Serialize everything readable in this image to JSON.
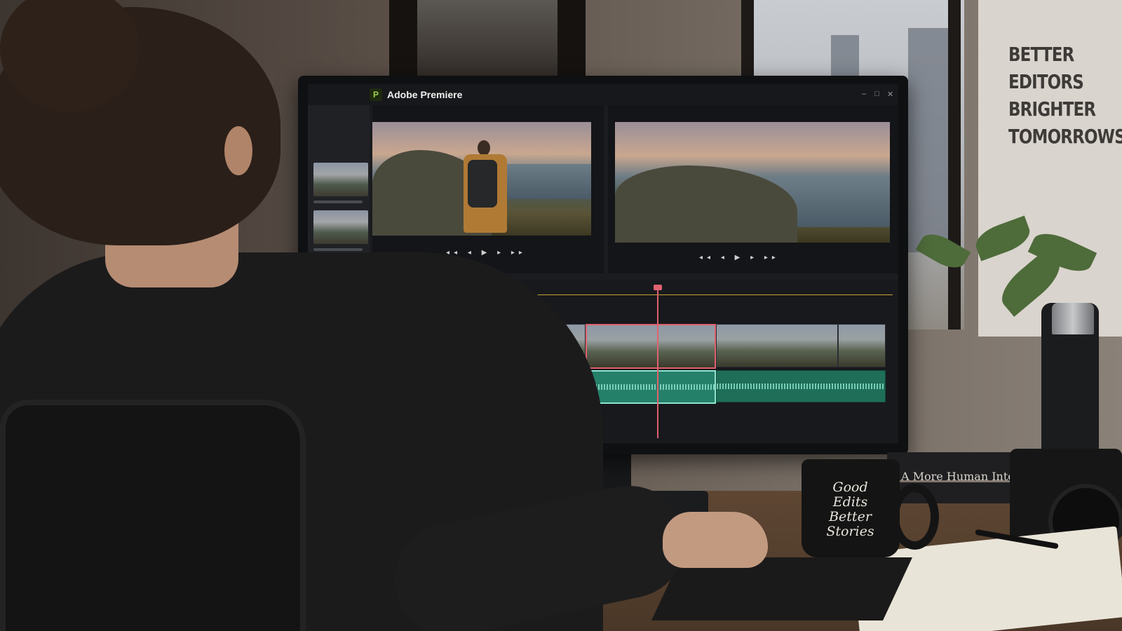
{
  "app": {
    "title": "Adobe Premiere",
    "logo_glyph": "P"
  },
  "window_controls": [
    "–",
    "□",
    "✕"
  ],
  "poster": {
    "lines": [
      "BETTER",
      "EDITORS",
      "BRIGHTER",
      "TOMORROWS"
    ]
  },
  "mug": {
    "lines": [
      "Good",
      "Edits",
      "Better",
      "Stories"
    ]
  },
  "book": {
    "title": "A More Human Internet"
  },
  "player": {
    "controls": "◂◂ ◂ ▶ ▸ ▸▸"
  },
  "colors": {
    "playhead": "#e0616f",
    "audio": "#1e6e58",
    "accent": "#9fd14a"
  }
}
